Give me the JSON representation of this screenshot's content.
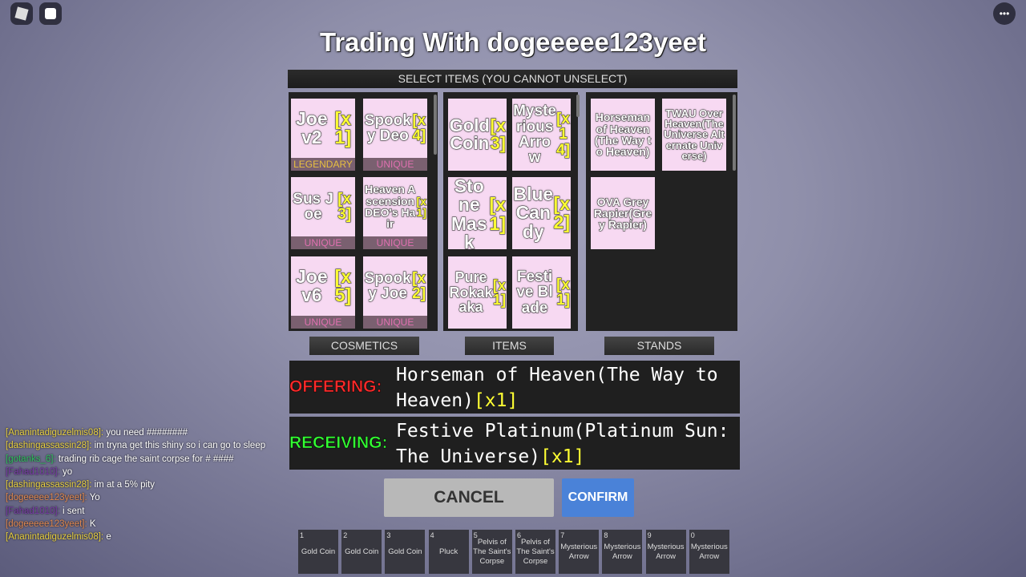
{
  "title": "Trading With dogeeeee123yeet",
  "select_bar": "SELECT ITEMS (YOU CANNOT UNSELECT)",
  "cosmetics": [
    {
      "name": "Joe v2",
      "qty": "[x1]",
      "rarity": "LEGENDARY",
      "rarity_color": "#e8c040"
    },
    {
      "name": "Spooky Deo",
      "qty": "[x4]",
      "rarity": "UNIQUE",
      "rarity_color": "#e070b0"
    },
    {
      "name": "Sus Joe",
      "qty": "[x3]",
      "rarity": "UNIQUE",
      "rarity_color": "#e070b0"
    },
    {
      "name": "Heaven Ascension DEO's Hair",
      "qty": "[x1]",
      "rarity": "UNIQUE",
      "rarity_color": "#e070b0"
    },
    {
      "name": "Joe v6",
      "qty": "[x5]",
      "rarity": "UNIQUE",
      "rarity_color": "#e070b0"
    },
    {
      "name": "Spooky Joe",
      "qty": "[x2]",
      "rarity": "UNIQUE",
      "rarity_color": "#e070b0"
    }
  ],
  "items": [
    {
      "name": "Gold Coin",
      "qty": "[x3]"
    },
    {
      "name": "Mysterious Arrow",
      "qty": "[x14]"
    },
    {
      "name": "Stone Mask",
      "qty": "[x1]"
    },
    {
      "name": "Blue Candy",
      "qty": "[x2]"
    },
    {
      "name": "Pure Rokakaka",
      "qty": "[x1]"
    },
    {
      "name": "Festive Blade",
      "qty": "[x1]"
    }
  ],
  "stands": [
    {
      "name": "Horseman of Heaven(The Way to Heaven)"
    },
    {
      "name": "TWAU Over Heaven(The Universe Alternate Universe)"
    },
    {
      "name": "OVA Grey Rapier(Grey Rapier)"
    }
  ],
  "tabs": {
    "cosmetics": "COSMETICS",
    "items": "ITEMS",
    "stands": "STANDS"
  },
  "offering": {
    "label": "OFFERING:",
    "item": "Horseman of Heaven(The Way to Heaven)",
    "qty": "[x1]",
    "color": "#ff2a2a"
  },
  "receiving": {
    "label": "RECEIVING:",
    "item": "Festive Platinum(Platinum Sun: The Universe)",
    "qty": "[x1]",
    "color": "#33ff33"
  },
  "cancel": "CANCEL",
  "confirm": "CONFIRM",
  "hotbar": [
    {
      "n": "1",
      "label": "Gold Coin"
    },
    {
      "n": "2",
      "label": "Gold Coin"
    },
    {
      "n": "3",
      "label": "Gold Coin"
    },
    {
      "n": "4",
      "label": "Pluck"
    },
    {
      "n": "5",
      "label": "Pelvis of The Saint's Corpse"
    },
    {
      "n": "6",
      "label": "Pelvis of The Saint's Corpse"
    },
    {
      "n": "7",
      "label": "Mysterious Arrow"
    },
    {
      "n": "8",
      "label": "Mysterious Arrow"
    },
    {
      "n": "9",
      "label": "Mysterious Arrow"
    },
    {
      "n": "0",
      "label": "Mysterious Arrow"
    }
  ],
  "chat": [
    {
      "user": "[Ananintadiguzelmis08]:",
      "msg": "you need ########",
      "color": "#e8d040"
    },
    {
      "user": "[dashingassassin28]:",
      "msg": "im tryna get this shiny so i can go to sleep",
      "color": "#e8d040"
    },
    {
      "user": "[gotanks_6]:",
      "msg": "trading rib cage the saint corpse for # ####",
      "color": "#30c060"
    },
    {
      "user": "[Fahad1010]:",
      "msg": "yo",
      "color": "#7a3aa8"
    },
    {
      "user": "[dashingassassin28]:",
      "msg": "im at a 5% pity",
      "color": "#e8d040"
    },
    {
      "user": "[dogeeeee123yeet]:",
      "msg": "Yo",
      "color": "#e08850"
    },
    {
      "user": "[Fahad1010]:",
      "msg": "i sent",
      "color": "#7a3aa8"
    },
    {
      "user": "[dogeeeee123yeet]:",
      "msg": "K",
      "color": "#e08850"
    },
    {
      "user": "[Ananintadiguzelmis08]:",
      "msg": "e",
      "color": "#e8d040"
    }
  ]
}
